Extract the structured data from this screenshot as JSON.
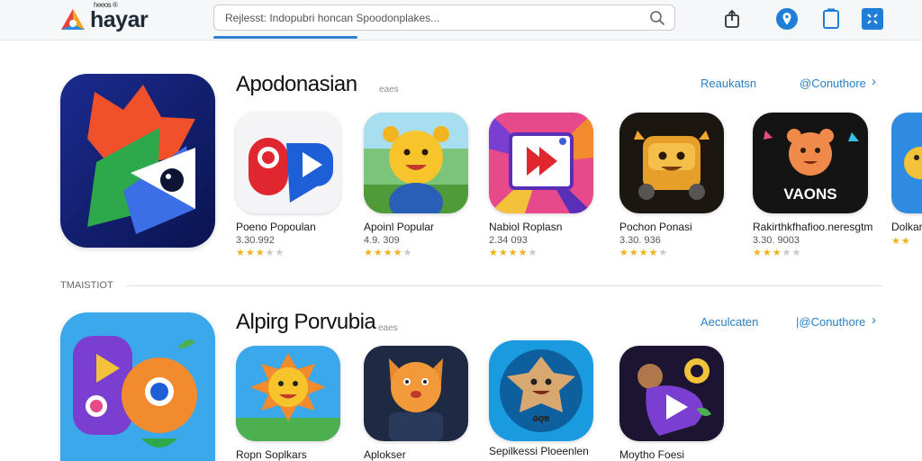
{
  "header": {
    "logo_text": "hayar",
    "logo_sup": "heeos ®",
    "search_placeholder": "Rejlesst: Indopubri honcan Spoodonplakes..."
  },
  "divider_label": "TMAISTIOT",
  "sections": [
    {
      "title": "Apodonasian",
      "count": "eaes",
      "link1": "Reaukatsn",
      "link2": "@Conuthore",
      "apps": [
        {
          "name": "Poeno Popoulan",
          "meta": "3.30.992",
          "rating": 3
        },
        {
          "name": "Apoinl Popular",
          "meta": "4.9.  309",
          "rating": 4
        },
        {
          "name": "Nabiol Roplasn",
          "meta": "2.34  093",
          "rating": 4
        },
        {
          "name": "Pochon Ponasi",
          "meta": "3.30. 936",
          "rating": 3.5
        },
        {
          "name": "Rakirthkfhafioo.neresgtm",
          "meta": "3.30. 9003",
          "rating": 3
        },
        {
          "name": "Dolkar",
          "meta": "",
          "rating": 2
        }
      ],
      "icon6_text": "VAONS"
    },
    {
      "title": "Alpirg Porvubia",
      "count": "eaes",
      "link1": "Aeculcaten",
      "link2": "|@Conuthore",
      "apps": [
        {
          "name": "Ropn Soplkars"
        },
        {
          "name": "Aplokser"
        },
        {
          "name": "Sepilkessi Ploeenlen"
        },
        {
          "name": "Moytho Foesi"
        }
      ],
      "icon3_text": "ǝǫɐ"
    }
  ]
}
